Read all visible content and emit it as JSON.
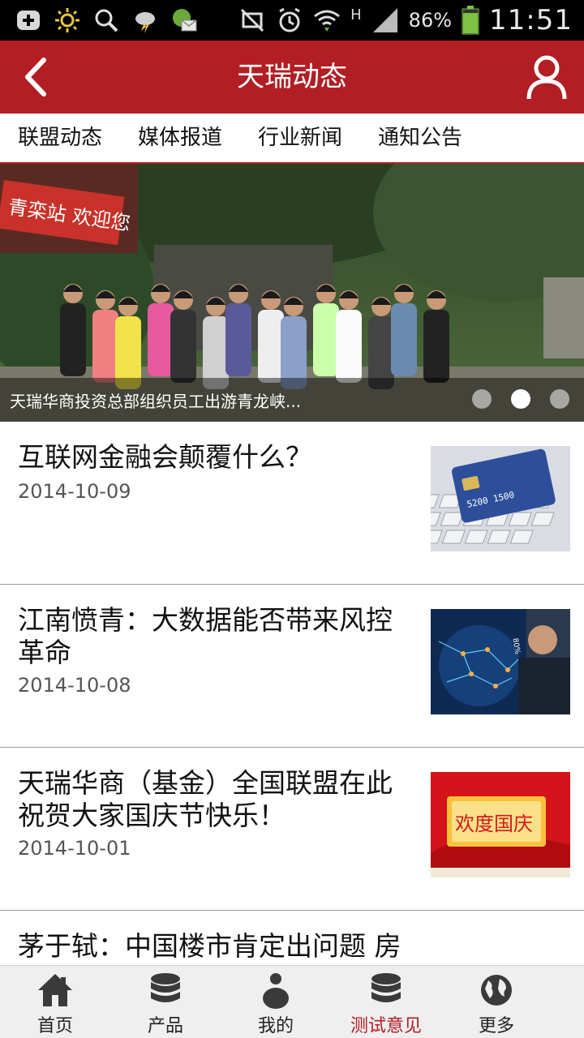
{
  "status_bar": {
    "left_icons": [
      "add-box-icon",
      "brightness-icon",
      "search-icon",
      "weather-icon",
      "mail-icon"
    ],
    "right_icons": [
      "vibrate-icon",
      "alarm-icon",
      "wifi-icon",
      "network-h-icon",
      "signal-icon",
      "battery-icon"
    ],
    "network_type": "H",
    "battery_percent": "86%",
    "battery_level": 0.86,
    "time": "11:51"
  },
  "header": {
    "title": "天瑞动态",
    "back_icon": "chevron-left-icon",
    "user_icon": "user-icon"
  },
  "tabs": [
    {
      "label": "联盟动态"
    },
    {
      "label": "媒体报道"
    },
    {
      "label": "行业新闻"
    },
    {
      "label": "通知公告"
    }
  ],
  "banner": {
    "sign_text": "青栾站 欢迎您",
    "caption": "天瑞华商投资总部组织员工出游青龙峡...",
    "slide_count": 3,
    "active_slide": 2
  },
  "news": [
    {
      "title": "互联网金融会颠覆什么？",
      "date": "2014-10-09",
      "thumb": "credit-card-keyboard"
    },
    {
      "title": "江南愤青：大数据能否带来风控革命",
      "date": "2014-10-08",
      "thumb": "businessman-data-network"
    },
    {
      "title": "天瑞华商（基金）全国联盟在此祝贺大家国庆节快乐！",
      "date": "2014-10-01",
      "thumb": "national-day-greeting"
    },
    {
      "title": "茅于轼：中国楼市肯定出问题 房",
      "date": "",
      "thumb": ""
    }
  ],
  "thumb_texts": {
    "card_number": "5200 1500",
    "percent_badge": "80%",
    "greeting": "欢度国庆"
  },
  "bottom_nav": [
    {
      "label": "首页",
      "icon": "home-icon",
      "active": false
    },
    {
      "label": "产品",
      "icon": "database-icon",
      "active": false
    },
    {
      "label": "我的",
      "icon": "person-icon",
      "active": false
    },
    {
      "label": "测试意见",
      "icon": "database-icon",
      "active": true
    },
    {
      "label": "更多",
      "icon": "globe-icon",
      "active": false
    }
  ],
  "colors": {
    "brand_red": "#b21e23",
    "status_bar": "#000000",
    "nav_bg": "#efefef"
  }
}
